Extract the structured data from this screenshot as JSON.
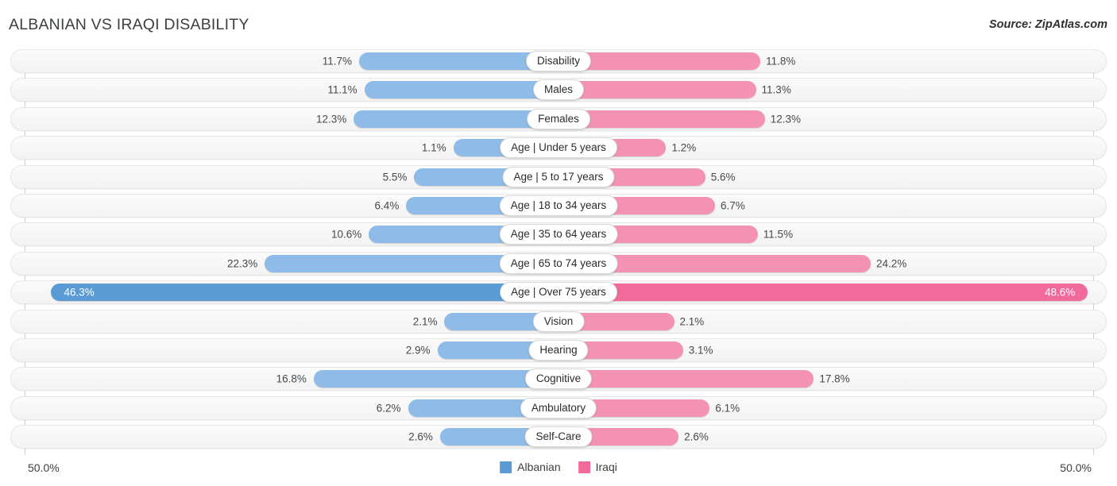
{
  "header": {
    "title": "ALBANIAN VS IRAQI DISABILITY",
    "source": "Source: ZipAtlas.com"
  },
  "footer": {
    "axis_left": "50.0%",
    "axis_right": "50.0%"
  },
  "chart_data": {
    "type": "bar",
    "orientation": "horizontal-diverging",
    "title": "ALBANIAN VS IRAQI DISABILITY",
    "subtitle": "",
    "xlabel": "",
    "ylabel": "",
    "xlim": [
      -50.0,
      50.0
    ],
    "axis_tick_labels": [
      "50.0%",
      "50.0%"
    ],
    "grid": false,
    "legend_position": "bottom-center",
    "unit": "%",
    "colors": {
      "albanian": "#8fbbe8",
      "iraqi": "#f492b4",
      "albanian_highlight": "#5b9bd5",
      "iraqi_highlight": "#f2699b",
      "row_background": "#f7f7f7",
      "pill_background": "#ffffff"
    },
    "legend": [
      {
        "name": "Albanian",
        "color": "#5b9bd5"
      },
      {
        "name": "Iraqi",
        "color": "#f2699b"
      }
    ],
    "categories": [
      "Disability",
      "Males",
      "Females",
      "Age | Under 5 years",
      "Age | 5 to 17 years",
      "Age | 18 to 34 years",
      "Age | 35 to 64 years",
      "Age | 65 to 74 years",
      "Age | Over 75 years",
      "Vision",
      "Hearing",
      "Cognitive",
      "Ambulatory",
      "Self-Care"
    ],
    "series": [
      {
        "name": "Albanian",
        "side": "left",
        "values": [
          11.7,
          11.1,
          12.3,
          1.1,
          5.5,
          6.4,
          10.6,
          22.3,
          46.3,
          2.1,
          2.9,
          16.8,
          6.2,
          2.6
        ]
      },
      {
        "name": "Iraqi",
        "side": "right",
        "values": [
          11.8,
          11.3,
          12.3,
          1.2,
          5.6,
          6.7,
          11.5,
          24.2,
          48.6,
          2.1,
          3.1,
          17.8,
          6.1,
          2.6
        ]
      }
    ],
    "rows": [
      {
        "label": "Disability",
        "left": 11.7,
        "right": 11.8,
        "left_text": "11.7%",
        "right_text": "11.8%",
        "highlight": false
      },
      {
        "label": "Males",
        "left": 11.1,
        "right": 11.3,
        "left_text": "11.1%",
        "right_text": "11.3%",
        "highlight": false
      },
      {
        "label": "Females",
        "left": 12.3,
        "right": 12.3,
        "left_text": "12.3%",
        "right_text": "12.3%",
        "highlight": false
      },
      {
        "label": "Age | Under 5 years",
        "left": 1.1,
        "right": 1.2,
        "left_text": "1.1%",
        "right_text": "1.2%",
        "highlight": false
      },
      {
        "label": "Age | 5 to 17 years",
        "left": 5.5,
        "right": 5.6,
        "left_text": "5.5%",
        "right_text": "5.6%",
        "highlight": false
      },
      {
        "label": "Age | 18 to 34 years",
        "left": 6.4,
        "right": 6.7,
        "left_text": "6.4%",
        "right_text": "6.7%",
        "highlight": false
      },
      {
        "label": "Age | 35 to 64 years",
        "left": 10.6,
        "right": 11.5,
        "left_text": "10.6%",
        "right_text": "11.5%",
        "highlight": false
      },
      {
        "label": "Age | 65 to 74 years",
        "left": 22.3,
        "right": 24.2,
        "left_text": "22.3%",
        "right_text": "24.2%",
        "highlight": false
      },
      {
        "label": "Age | Over 75 years",
        "left": 46.3,
        "right": 48.6,
        "left_text": "46.3%",
        "right_text": "48.6%",
        "highlight": true
      },
      {
        "label": "Vision",
        "left": 2.1,
        "right": 2.1,
        "left_text": "2.1%",
        "right_text": "2.1%",
        "highlight": false
      },
      {
        "label": "Hearing",
        "left": 2.9,
        "right": 3.1,
        "left_text": "2.9%",
        "right_text": "3.1%",
        "highlight": false
      },
      {
        "label": "Cognitive",
        "left": 16.8,
        "right": 17.8,
        "left_text": "16.8%",
        "right_text": "17.8%",
        "highlight": false
      },
      {
        "label": "Ambulatory",
        "left": 6.2,
        "right": 6.1,
        "left_text": "6.2%",
        "right_text": "6.1%",
        "highlight": false
      },
      {
        "label": "Self-Care",
        "left": 2.6,
        "right": 2.6,
        "left_text": "2.6%",
        "right_text": "2.6%",
        "highlight": false
      }
    ]
  }
}
